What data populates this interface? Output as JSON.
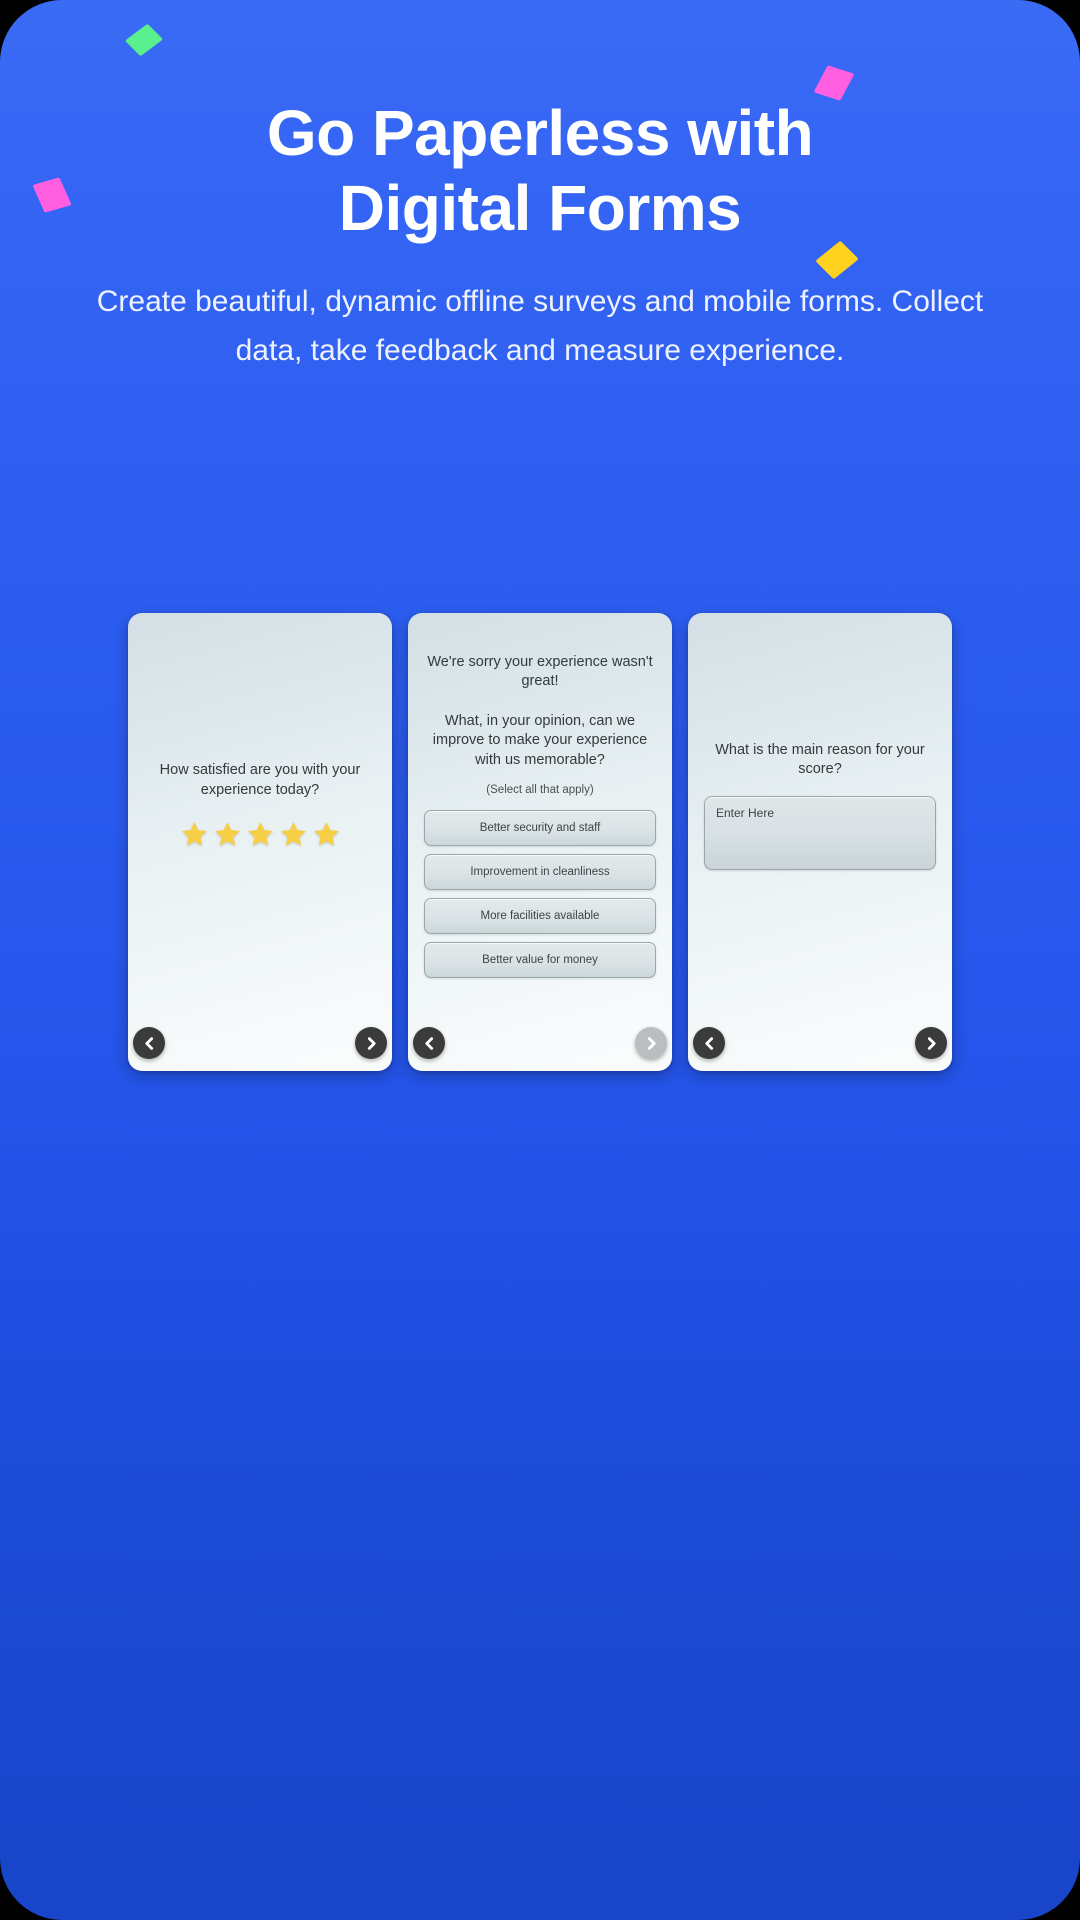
{
  "hero": {
    "title_line1": "Go Paperless with",
    "title_line2": "Digital Forms",
    "subtitle": "Create beautiful, dynamic offline surveys and mobile forms. Collect data, take feedback and measure experience.",
    "background_color": "#2a5bef",
    "title_color": "#ffffff"
  },
  "confetti": [
    {
      "name": "green-diamond",
      "color": "#5bf08e"
    },
    {
      "name": "pink-square-top-right",
      "color": "#ff5fe0"
    },
    {
      "name": "pink-square-left",
      "color": "#ff5fe0"
    },
    {
      "name": "yellow-diamond",
      "color": "#ffd21f"
    }
  ],
  "cards": [
    {
      "question": "How satisfied are you with your experience today?",
      "rating": {
        "stars_total": 5,
        "stars_filled": 5,
        "star_color": "#f7cf46"
      },
      "nav": {
        "prev_label": "‹",
        "next_label": "›",
        "prev_enabled": true,
        "next_enabled": true
      }
    },
    {
      "headline": "We're sorry your experience wasn't great!",
      "question": "What, in your opinion, can we improve to make your experience with us memorable?",
      "hint": "(Select all that apply)",
      "options": [
        "Better security and staff",
        "Improvement in cleanliness",
        "More facilities available",
        "Better value for money"
      ],
      "nav": {
        "prev_label": "‹",
        "next_label": "›",
        "prev_enabled": true,
        "next_enabled": false
      }
    },
    {
      "question": "What is the main reason for your score?",
      "input_placeholder": "Enter Here",
      "nav": {
        "prev_label": "‹",
        "next_label": "›",
        "prev_enabled": true,
        "next_enabled": true
      }
    }
  ]
}
